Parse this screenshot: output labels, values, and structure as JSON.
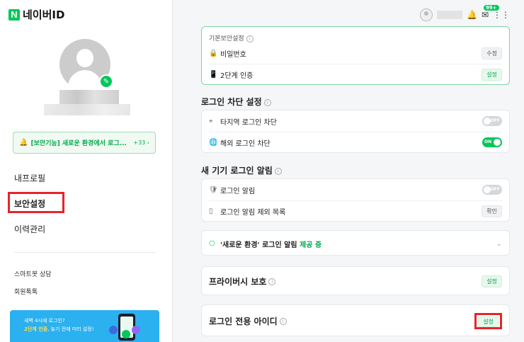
{
  "brand": {
    "logo_letter": "N",
    "logo_text": "네이버ID"
  },
  "sidebar": {
    "alert": {
      "text": "[보안기능] 새로운 환경에서 로그...",
      "count": "+33 ›"
    },
    "nav": [
      {
        "label": "내프로필"
      },
      {
        "label": "보안설정"
      },
      {
        "label": "이력관리"
      }
    ],
    "links": [
      {
        "label": "스마트봇 상담"
      },
      {
        "label": "회원톡톡"
      }
    ],
    "banner": {
      "line1": "새벽 4시에 로그인?",
      "line2_highlight": "2단계 인증",
      "line2_rest": ", 놓기 전에 미리 설정!"
    }
  },
  "topbar": {
    "badge": "99+"
  },
  "basic_security": {
    "title": "기본보안설정",
    "rows": [
      {
        "label": "비밀번호",
        "action": "수정"
      },
      {
        "label": "2단계 인증",
        "action": "설정"
      }
    ]
  },
  "login_block": {
    "title": "로그인 차단 설정",
    "rows": [
      {
        "label": "타지역 로그인 차단",
        "toggle": "OFF"
      },
      {
        "label": "해외 로그인 차단",
        "toggle": "ON"
      }
    ]
  },
  "new_device": {
    "title": "새 기기 로그인 알림",
    "rows": [
      {
        "label": "로그인 알림",
        "toggle": "OFF"
      },
      {
        "label": "로그인 알림 제외 목록",
        "action": "확인"
      }
    ]
  },
  "new_env": {
    "label": "'새로운 환경' 로그인 알림",
    "status": "제공 중"
  },
  "privacy": {
    "label": "프라이버시 보호",
    "action": "설정"
  },
  "login_only_id": {
    "label": "로그인 전용 아이디",
    "action": "설정"
  }
}
